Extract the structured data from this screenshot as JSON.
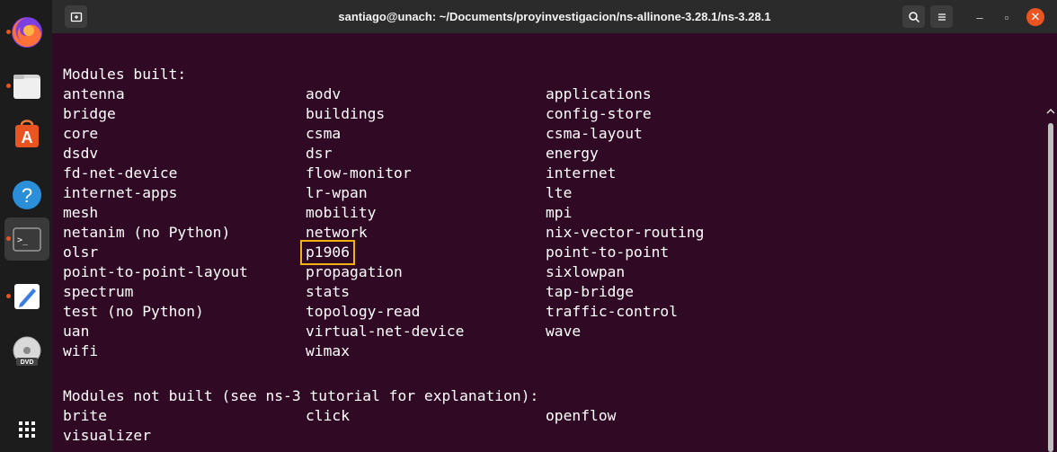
{
  "window": {
    "title": "santiago@unach: ~/Documents/proyinvestigacion/ns-allinone-3.28.1/ns-3.28.1"
  },
  "toolbar": {
    "new_tab_icon": "new-tab-icon",
    "search_icon": "search-icon",
    "menu_icon": "hamburger-menu-icon",
    "minimize_glyph": "–",
    "maximize_glyph": "▫",
    "close_glyph": "✕"
  },
  "dock": {
    "items": [
      {
        "name": "firefox-icon",
        "running": true
      },
      {
        "name": "files-icon",
        "running": true
      },
      {
        "name": "software-store-icon",
        "running": false
      },
      {
        "name": "help-icon",
        "running": false
      },
      {
        "name": "terminal-icon",
        "running": true,
        "active": true
      },
      {
        "name": "text-editor-icon",
        "running": true
      },
      {
        "name": "dvd-icon",
        "running": false
      },
      {
        "name": "show-apps-icon",
        "running": false
      }
    ]
  },
  "terminal": {
    "built_heading": "Modules built:",
    "built_rows": [
      [
        "antenna",
        "aodv",
        "applications"
      ],
      [
        "bridge",
        "buildings",
        "config-store"
      ],
      [
        "core",
        "csma",
        "csma-layout"
      ],
      [
        "dsdv",
        "dsr",
        "energy"
      ],
      [
        "fd-net-device",
        "flow-monitor",
        "internet"
      ],
      [
        "internet-apps",
        "lr-wpan",
        "lte"
      ],
      [
        "mesh",
        "mobility",
        "mpi"
      ],
      [
        "netanim (no Python)",
        "network",
        "nix-vector-routing"
      ],
      [
        "olsr",
        "p1906",
        "point-to-point"
      ],
      [
        "point-to-point-layout",
        "propagation",
        "sixlowpan"
      ],
      [
        "spectrum",
        "stats",
        "tap-bridge"
      ],
      [
        "test (no Python)",
        "topology-read",
        "traffic-control"
      ],
      [
        "uan",
        "virtual-net-device",
        "wave"
      ],
      [
        "wifi",
        "wimax",
        ""
      ]
    ],
    "highlighted_module": "p1906",
    "not_built_heading": "Modules not built (see ns-3 tutorial for explanation):",
    "not_built_rows": [
      [
        "brite",
        "click",
        "openflow"
      ],
      [
        "visualizer",
        "",
        ""
      ]
    ]
  },
  "colors": {
    "terminal_bg": "#300a24",
    "highlight": "#f1b212",
    "titlebar_bg": "#2b2b2b",
    "close_button": "#e95420"
  }
}
